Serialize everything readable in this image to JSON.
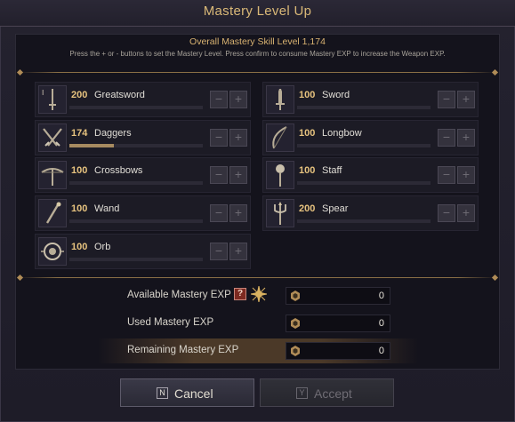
{
  "window": {
    "title": "Mastery Level Up"
  },
  "header": {
    "overall": "Overall Mastery Skill Level 1,174",
    "instructions": "Press the + or - buttons to set the Mastery Level. Press confirm to consume Mastery EXP to increase the Weapon EXP."
  },
  "skills": [
    {
      "level": "200",
      "name": "Greatsword",
      "icon": "greatsword-icon",
      "progress": 0
    },
    {
      "level": "100",
      "name": "Sword",
      "icon": "sword-icon",
      "progress": 0
    },
    {
      "level": "174",
      "name": "Daggers",
      "icon": "daggers-icon",
      "progress": 0.33
    },
    {
      "level": "100",
      "name": "Longbow",
      "icon": "longbow-icon",
      "progress": 0
    },
    {
      "level": "100",
      "name": "Crossbows",
      "icon": "crossbow-icon",
      "progress": 0
    },
    {
      "level": "100",
      "name": "Staff",
      "icon": "staff-icon",
      "progress": 0
    },
    {
      "level": "100",
      "name": "Wand",
      "icon": "wand-icon",
      "progress": 0
    },
    {
      "level": "200",
      "name": "Spear",
      "icon": "spear-icon",
      "progress": 0
    },
    {
      "level": "100",
      "name": "Orb",
      "icon": "orb-icon",
      "progress": 0
    }
  ],
  "controls": {
    "minus": "−",
    "plus": "+"
  },
  "exp": {
    "available_label": "Available Mastery EXP",
    "available_value": "0",
    "help": "?",
    "used_label": "Used Mastery EXP",
    "used_value": "0",
    "remaining_label": "Remaining Mastery EXP",
    "remaining_value": "0"
  },
  "buttons": {
    "cancel_key": "N",
    "cancel_label": "Cancel",
    "accept_key": "Y",
    "accept_label": "Accept"
  },
  "colors": {
    "accent": "#d9b877",
    "level": "#e7c37f",
    "help": "#7d2a21"
  }
}
